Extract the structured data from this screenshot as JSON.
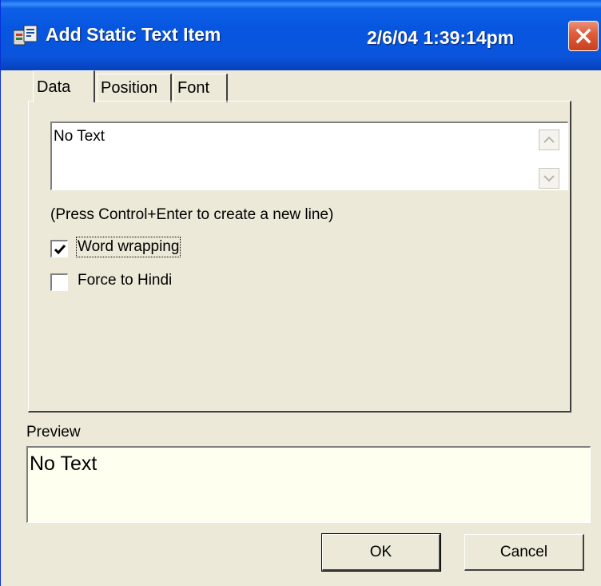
{
  "window": {
    "title": "Add Static Text Item",
    "datetime": "2/6/04 1:39:14pm"
  },
  "tabs": [
    {
      "label": "Data",
      "active": true
    },
    {
      "label": "Position",
      "active": false
    },
    {
      "label": "Font",
      "active": false
    }
  ],
  "text_field": {
    "value": "No Text"
  },
  "hint": "(Press Control+Enter to create a new line)",
  "checkboxes": [
    {
      "label": "Word wrapping",
      "checked": true
    },
    {
      "label": "Force to Hindi",
      "checked": false
    }
  ],
  "preview": {
    "label": "Preview",
    "value": "No Text"
  },
  "buttons": {
    "ok": "OK",
    "cancel": "Cancel"
  },
  "icons": {
    "app": "app-icon",
    "close": "close-icon",
    "scroll_up": "scroll-up-icon",
    "scroll_down": "scroll-down-icon",
    "check": "checkmark-icon"
  },
  "colors": {
    "titlebar": "#0756e0",
    "close_button": "#e25d3c",
    "dialog_bg": "#ece9d8",
    "preview_bg": "#fffff0"
  }
}
